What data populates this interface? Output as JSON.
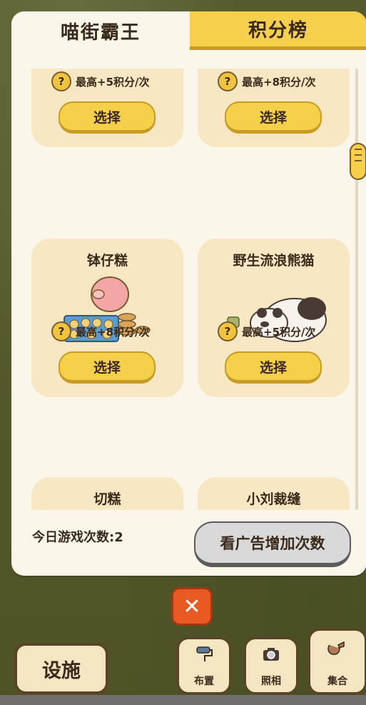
{
  "tabs": {
    "active": "喵街霸王",
    "inactive": "积分榜"
  },
  "cards": [
    {
      "title": "",
      "score": "最高+5积分/次",
      "button": "选择"
    },
    {
      "title": "",
      "score": "最高+8积分/次",
      "button": "选择"
    },
    {
      "title": "钵仔糕",
      "score": "最高+8积分/次",
      "button": "选择"
    },
    {
      "title": "野生流浪熊猫",
      "score": "最高+5积分/次",
      "button": "选择"
    },
    {
      "title": "切糕",
      "score": "",
      "button": ""
    },
    {
      "title": "小刘裁缝",
      "score": "",
      "button": ""
    }
  ],
  "question_mark": "?",
  "footer": {
    "plays_today": "今日游戏次数:2",
    "ad_button": "看广告增加次数"
  },
  "close_symbol": "✕",
  "bottom_bar": {
    "facility": "设施",
    "layout": "布置",
    "photo": "照相",
    "gather": "集合"
  },
  "colors": {
    "accent": "#f6cf4b",
    "close": "#e85a22",
    "card": "#f7e7c2"
  }
}
